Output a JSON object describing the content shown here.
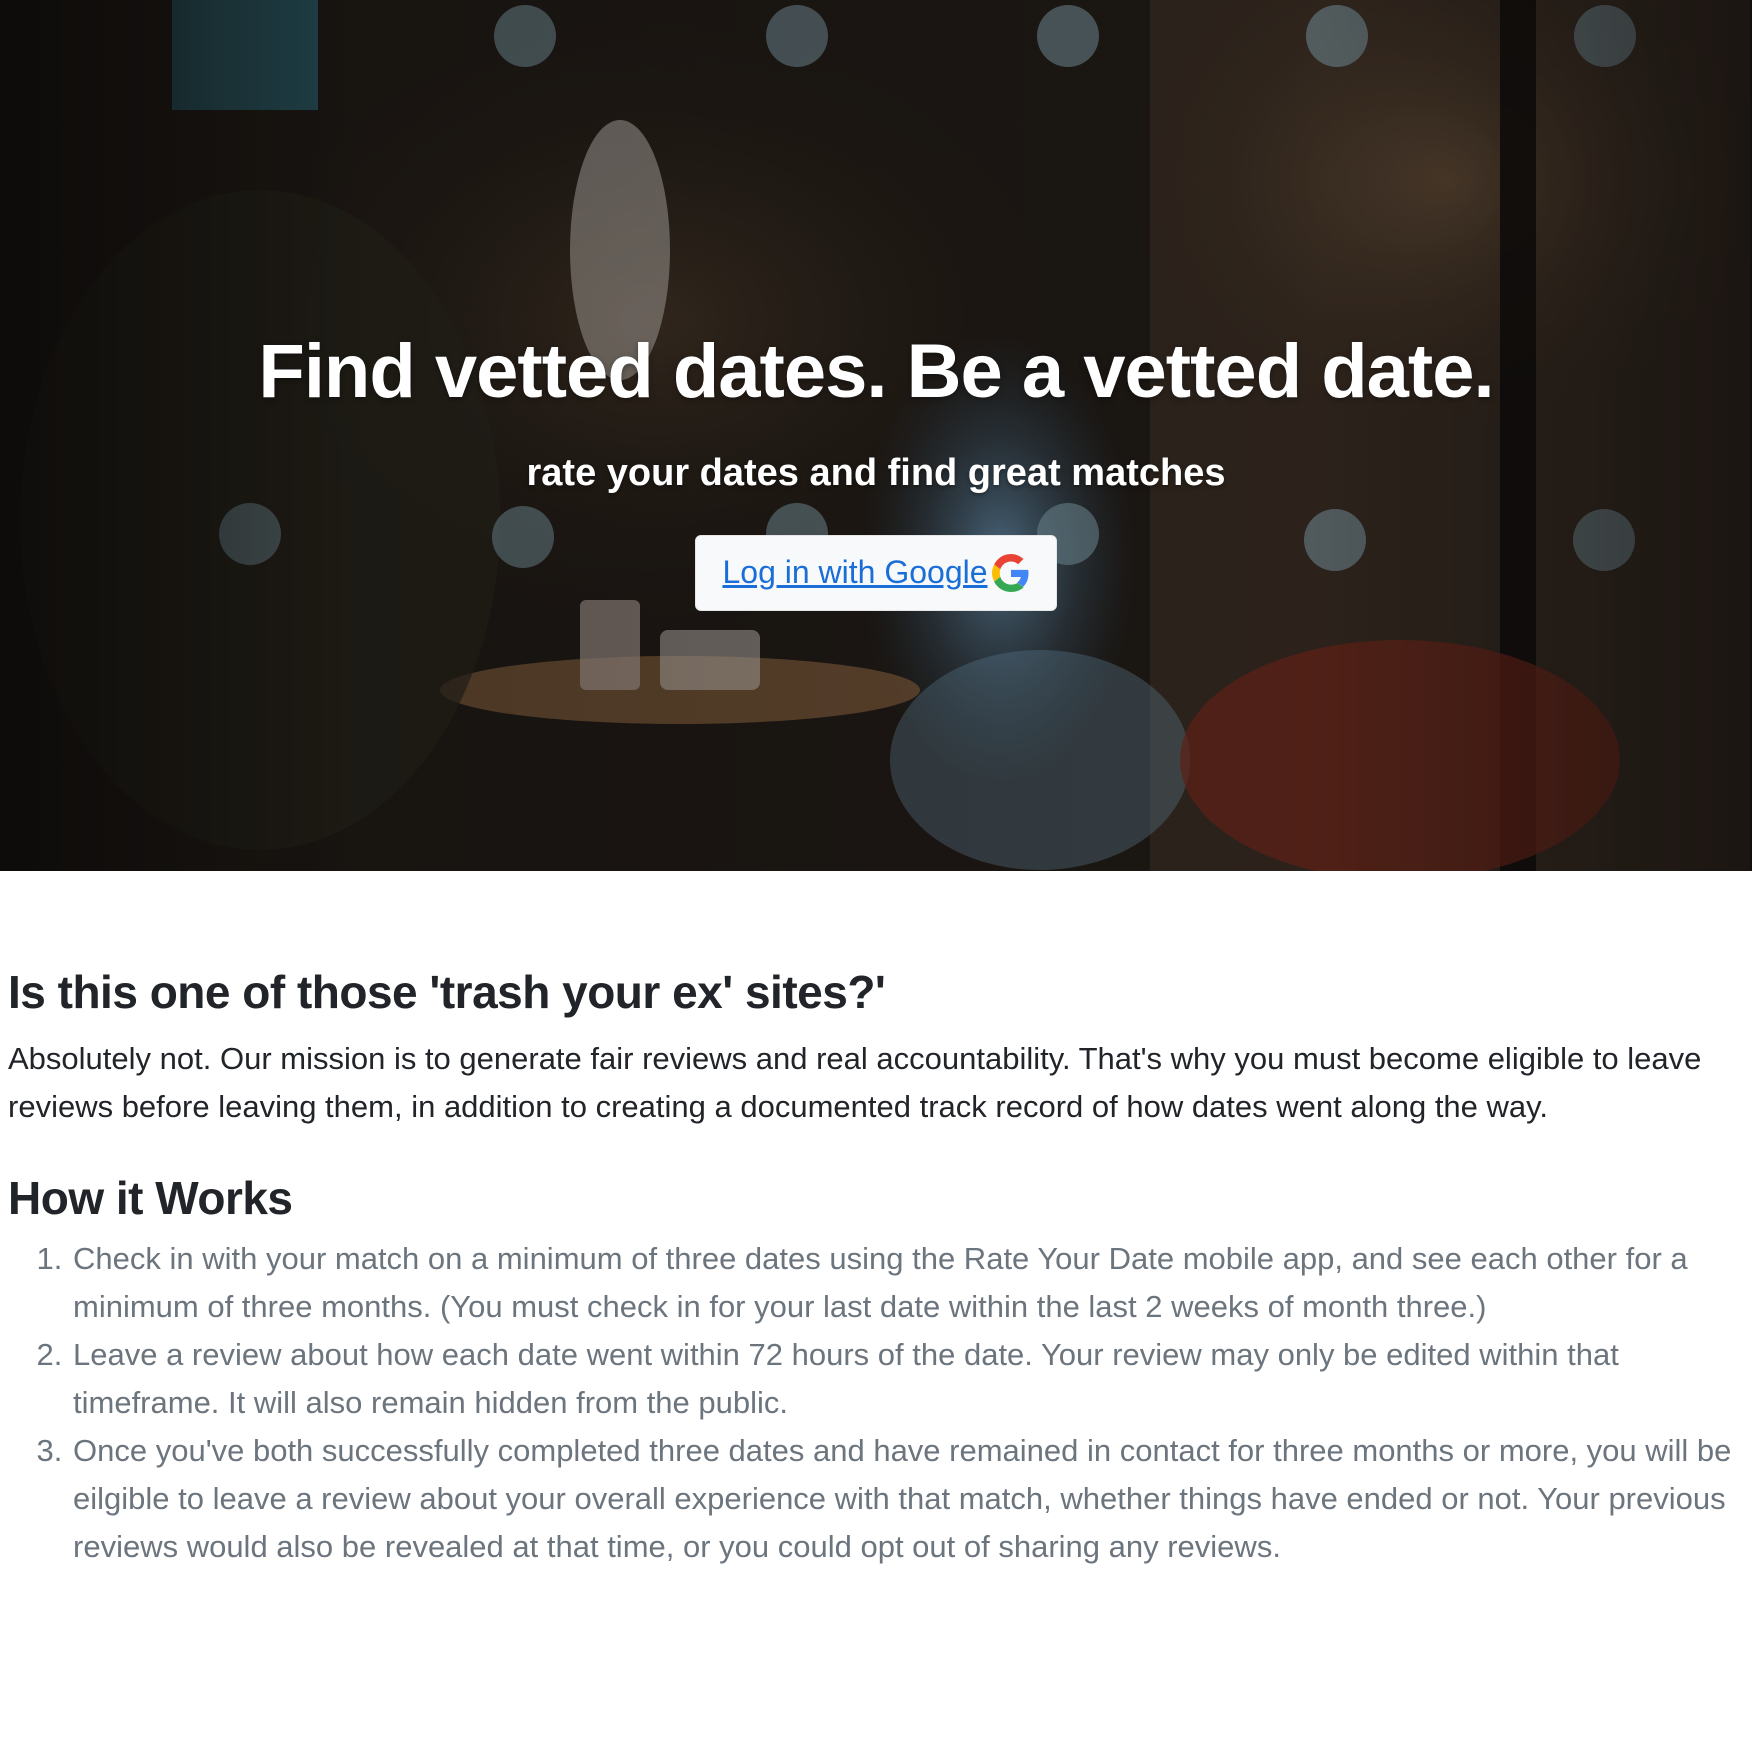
{
  "hero": {
    "title": "Find vetted dates. Be a vetted date.",
    "subtitle": "rate your dates and find great matches",
    "login_button_label": "Log in with Google",
    "login_icon": "google-icon",
    "colors": {
      "button_bg": "#f8f9fa",
      "link": "#1a6ed8"
    }
  },
  "faq": {
    "heading": "Is this one of those 'trash your ex' sites?'",
    "answer": "Absolutely not. Our mission is to generate fair reviews and real accountability. That's why you must become eligible to leave reviews before leaving them, in addition to creating a documented track record of how dates went along the way."
  },
  "how_it_works": {
    "heading": "How it Works",
    "steps": [
      "Check in with your match on a minimum of three dates using the Rate Your Date mobile app, and see each other for a minimum of three months. (You must check in for your last date within the last 2 weeks of month three.)",
      "Leave a review about how each date went within 72 hours of the date. Your review may only be edited within that timeframe. It will also remain hidden from the public.",
      "Once you've both successfully completed three dates and have remained in contact for three months or more, you will be eilgible to leave a review about your overall experience with that match, whether things have ended or not. Your previous reviews would also be revealed at that time, or you could opt out of sharing any reviews."
    ],
    "text_color": "#6c757d"
  }
}
